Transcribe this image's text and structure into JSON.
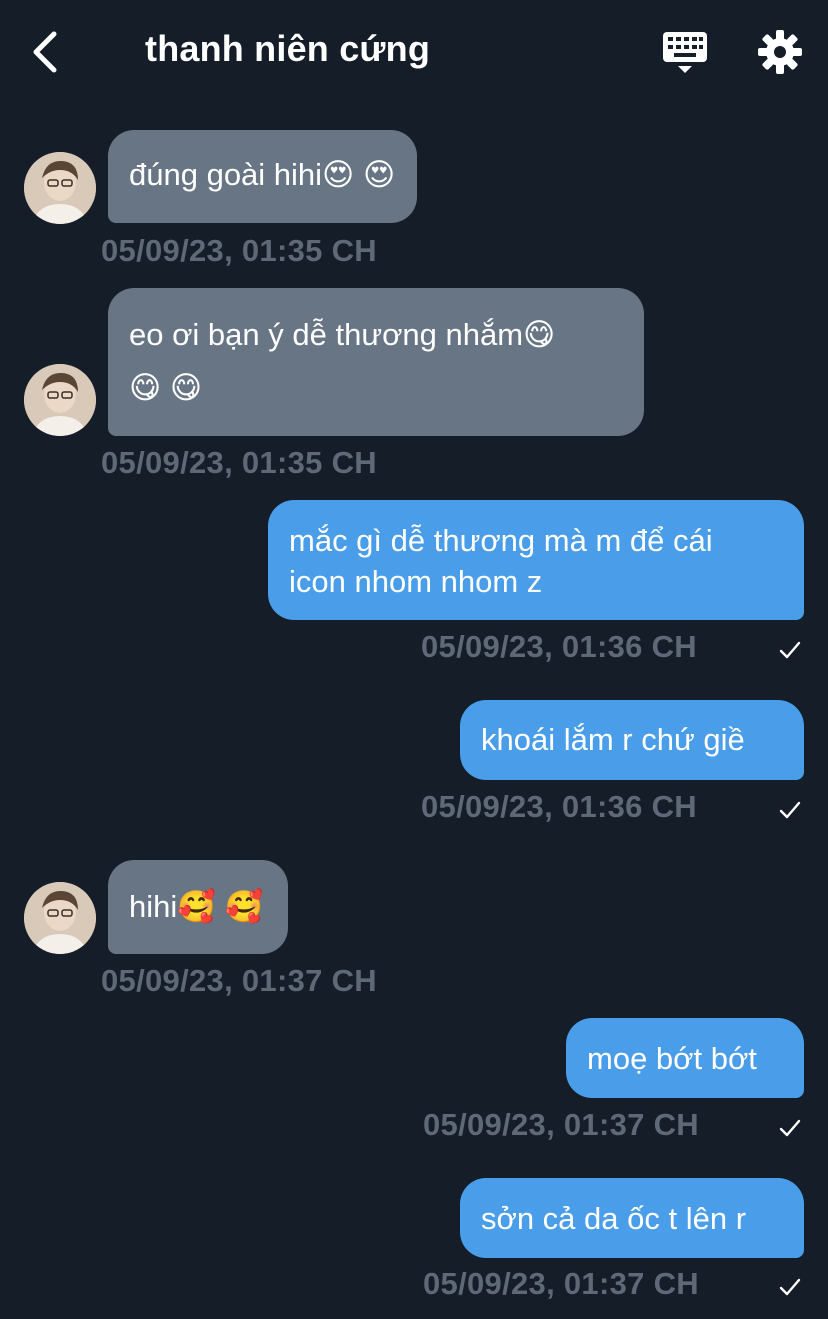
{
  "header": {
    "title": "thanh niên cứng",
    "back_icon": "chevron-left-icon",
    "keyboard_icon": "keyboard-icon",
    "settings_icon": "gear-icon"
  },
  "messages": [
    {
      "direction": "in",
      "lines": [
        "đúng goài hihi😍 😍"
      ],
      "timestamp": "05/09/23, 01:35 CH"
    },
    {
      "direction": "in",
      "lines": [
        "eo ơi bạn ý dễ thương nhắm😋",
        "😋 😋"
      ],
      "timestamp": "05/09/23, 01:35 CH"
    },
    {
      "direction": "out",
      "lines": [
        "mắc gì dễ thương mà m để cái",
        "icon nhom nhom z"
      ],
      "timestamp": "05/09/23, 01:36 CH",
      "read": true
    },
    {
      "direction": "out",
      "lines": [
        "khoái lắm r chứ giề"
      ],
      "timestamp": "05/09/23, 01:36 CH",
      "read": true
    },
    {
      "direction": "in",
      "lines": [
        "hihi🥰 🥰"
      ],
      "timestamp": "05/09/23, 01:37 CH"
    },
    {
      "direction": "out",
      "lines": [
        "moẹ bớt bớt"
      ],
      "timestamp": "05/09/23, 01:37 CH",
      "read": true
    },
    {
      "direction": "out",
      "lines": [
        "sởn cả da ốc t lên r"
      ],
      "timestamp": "05/09/23, 01:37 CH",
      "read": true
    }
  ],
  "colors": {
    "background": "#151d28",
    "incoming_bubble": "#687584",
    "outgoing_bubble": "#4a9de8",
    "timestamp": "#5e6877"
  }
}
